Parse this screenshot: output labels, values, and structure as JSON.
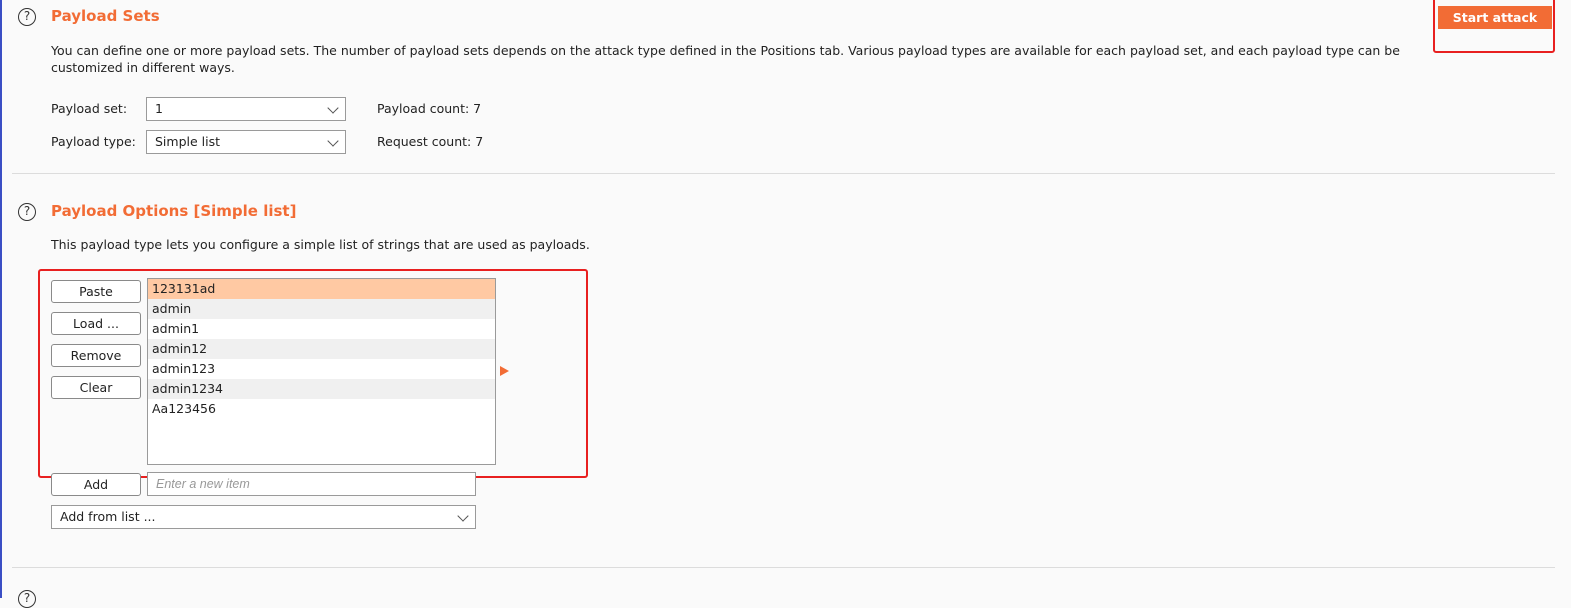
{
  "payload_sets": {
    "title": "Payload Sets",
    "description": "You can define one or more payload sets. The number of payload sets depends on the attack type defined in the Positions tab. Various payload types are available for each payload set, and each payload type can be customized in different ways.",
    "payload_set_label": "Payload set:",
    "payload_set_value": "1",
    "payload_type_label": "Payload type:",
    "payload_type_value": "Simple list",
    "payload_count_label": "Payload count: 7",
    "request_count_label": "Request count: 7",
    "start_attack_label": "Start attack"
  },
  "payload_options": {
    "title": "Payload Options [Simple list]",
    "description": "This payload type lets you configure a simple list of strings that are used as payloads.",
    "buttons": {
      "paste": "Paste",
      "load": "Load ...",
      "remove": "Remove",
      "clear": "Clear",
      "add": "Add"
    },
    "items": [
      "123131ad",
      "admin",
      "admin1",
      "admin12",
      "admin123",
      "admin1234",
      "Aa123456"
    ],
    "selected_index": 0,
    "new_item_placeholder": "Enter a new item",
    "add_from_list_label": "Add from list ..."
  },
  "help_icon_glyph": "?",
  "colors": {
    "accent": "#f26c35",
    "highlight": "#e82020",
    "selected_row": "#ffc9a3"
  }
}
